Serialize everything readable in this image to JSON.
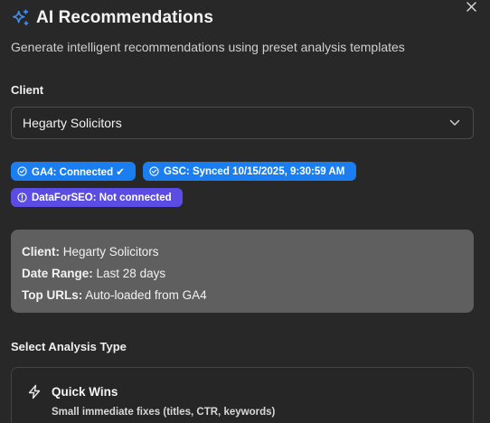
{
  "header": {
    "title": "AI Recommendations",
    "subtitle": "Generate intelligent recommendations using preset analysis templates",
    "icon": "sparkles-icon",
    "accent_color": "#1a7df0"
  },
  "client": {
    "label": "Client",
    "selected": "Hegarty Solicitors"
  },
  "badges": [
    {
      "label": "GA4: Connected ✔",
      "icon": "check-circle-icon",
      "color": "#1a7df0"
    },
    {
      "label": "GSC: Synced 10/15/2025, 9:30:59 AM",
      "icon": "check-circle-icon",
      "color": "#1a7df0"
    },
    {
      "label": "DataForSEO: Not connected",
      "icon": "alert-circle-icon",
      "color": "#5b4de3"
    }
  ],
  "summary": {
    "client_key": "Client:",
    "client_value": "Hegarty Solicitors",
    "range_key": "Date Range:",
    "range_value": "Last 28 days",
    "urls_key": "Top URLs:",
    "urls_value": "Auto-loaded from GA4"
  },
  "analysis": {
    "section_title": "Select Analysis Type",
    "cards": [
      {
        "title": "Quick Wins",
        "description": "Small immediate fixes (titles, CTR, keywords)",
        "icon": "lightning-icon"
      }
    ]
  }
}
